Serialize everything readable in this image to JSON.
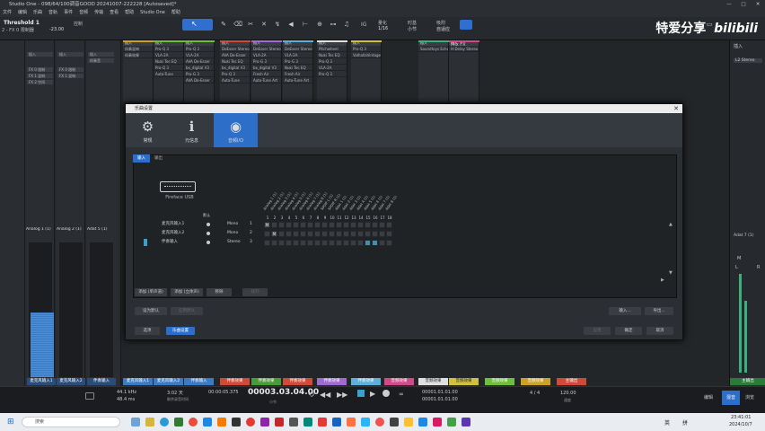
{
  "window": {
    "title": "Studio One - 098/64/100调音GOOD 20241007-222228 [Autosaved]*",
    "controls": [
      "—",
      "□",
      "✕"
    ]
  },
  "menu": [
    "文件",
    "编辑",
    "乐曲",
    "音轨",
    "事件",
    "音频",
    "传输",
    "查看",
    "帮助",
    "Studio One",
    "帮助"
  ],
  "toolbar": {
    "track_label": "Threshold 1",
    "track_sub": "2 - FX 0 限制器",
    "mode_label": "控制",
    "value": "-23.00",
    "quantize_label": "量化",
    "quantize_val": "1/16",
    "timebase_label": "时基",
    "timebase_val": "小节",
    "snap_label": "吸附",
    "snap_val": "自适应",
    "ig": "IG"
  },
  "watermark": {
    "text": "特爱分享",
    "logo": "bilibili"
  },
  "left_channels": [
    {
      "name": "Analog 1 (1)",
      "ins": [
        "插入",
        "FX 0 限制",
        "FX 1 混响",
        "FX 2 空间"
      ],
      "bottom": "麦克风输入1"
    },
    {
      "name": "Analog 2 (1)",
      "ins": [
        "插入",
        "FX 0 限制",
        "FX 1 混响"
      ],
      "bottom": "麦克风输入2"
    },
    {
      "name": "Adat 5 (1)",
      "ins": [
        "插入",
        "伴奏音"
      ],
      "bottom": "伴奏输入"
    }
  ],
  "insert_columns": [
    {
      "color": "#c9a227",
      "slots": [
        "插入",
        "伴奏混响",
        "伴奏效果"
      ]
    },
    {
      "color": "#6fbf3a",
      "slots": [
        "插入",
        "Pro-Q 3",
        "VLA-2A",
        "Nuki Tec EQ",
        "Pro-Q 3",
        "Auto-Tune"
      ]
    },
    {
      "color": "#6fbf3a",
      "slots": [
        "插入",
        "Pro-Q 3",
        "VLA-2A",
        "AVA De-Esser",
        "bx_digital V3",
        "Pro-G 3",
        "AVA De-Esser"
      ]
    },
    {
      "color": "#d04a3a",
      "slots": [
        "插入",
        "DeEsser Stereo",
        "AVA De-Esser",
        "Nuki Tec EQ",
        "bx_digital V3",
        "Pro-Q 3",
        "Auto-Tune"
      ]
    },
    {
      "color": "#a06bd0",
      "slots": [
        "插入",
        "DeEsser Stereo",
        "VLA-2A",
        "Pro-G 3",
        "bx_digital V3",
        "Fresh Air",
        "Auto-Tune Art"
      ]
    },
    {
      "color": "#5fb0d9",
      "slots": [
        "插入",
        "DeEsser Stereo",
        "VLA-2A",
        "Pro-G 3",
        "Nuki Tec EQ",
        "Fresh Air",
        "Auto-Tune Art"
      ]
    },
    {
      "color": "#e0e0e0",
      "slots": [
        "插入",
        "Pitchwheel",
        "Nuki Tec EQ",
        "Pro-Q 3",
        "VLA-2A",
        "Pro-Q 3"
      ]
    },
    {
      "color": "#d0c040",
      "slots": [
        "插入",
        "Pro-Q 3",
        "ValhallaVintage"
      ]
    },
    {
      "color": "#3ab07a",
      "slots": [
        "插入",
        "Soundtoys Echo"
      ]
    },
    {
      "color": "#d04a8a",
      "slots": [
        "插入",
        "H-Delay Stereo"
      ]
    }
  ],
  "mix_fx_label": "Mix FX",
  "right_panel": {
    "label": "插入",
    "stereo": "L2 Stereo",
    "adat": "Adat 7 (1)",
    "mono": "M",
    "l": "L",
    "r": "R",
    "bottom": "主输出"
  },
  "bottom_strips": [
    {
      "label": "麦克风输入1",
      "color": "#3b7bc4"
    },
    {
      "label": "麦克风输入2",
      "color": "#3b7bc4"
    },
    {
      "label": "伴奏输入",
      "color": "#3b7bc4"
    },
    {
      "label": "伴奏效果",
      "color": "#d04a3a"
    },
    {
      "label": "伴奏效果",
      "color": "#4a9a3a"
    },
    {
      "label": "伴奏效果",
      "color": "#d04a3a"
    },
    {
      "label": "伴奏效果",
      "color": "#a06bd0"
    },
    {
      "label": "伴奏效果",
      "color": "#5fb0d9"
    },
    {
      "label": "音频效果",
      "color": "#d04a8a"
    },
    {
      "label": "音频效果",
      "color": "#e0e0e0"
    },
    {
      "label": "音频效果",
      "color": "#d0c040"
    },
    {
      "label": "音频效果",
      "color": "#6fbf3a"
    },
    {
      "label": "音频效果",
      "color": "#c9a227"
    },
    {
      "label": "主输出",
      "color": "#d04a3a"
    }
  ],
  "transport": {
    "sample_rate": "44.1 kHz",
    "latency": "48.4 ms",
    "time": "3:02 天",
    "rec": "剩余录音时间",
    "pos_small": "00:00:05.375",
    "pos_big": "00003.03.04.00",
    "bar_label": "小节",
    "loop_start": "00001.01.01.00",
    "loop_end": "00001.01.01.00",
    "sig": "4 / 4",
    "tempo": "120.00",
    "tempo_label": "速度",
    "edit": "编辑",
    "mix": "混音",
    "browse": "浏览"
  },
  "dialog": {
    "title": "乐曲设置",
    "close": "✕",
    "tabs": [
      {
        "label": "常规",
        "icon": "⚙"
      },
      {
        "label": "元信息",
        "icon": "ℹ"
      },
      {
        "label": "音频I/O",
        "icon": "◉"
      }
    ],
    "sub_tabs": [
      "输入",
      "输出"
    ],
    "device": "Fireface USB",
    "default_header": "默认",
    "columns": [
      "Analog 1 (1)",
      "Analog 2 (1)",
      "Analog 3 (1)",
      "Analog 4 (1)",
      "Analog 5 (1)",
      "Analog 6 (1)",
      "Analog 7 (1)",
      "Analog 8 (1)",
      "SPDIF L (1)",
      "SPDIF R (1)",
      "Adat 1 (1)",
      "Adat 2 (1)",
      "Adat 3 (1)",
      "Adat 4 (1)",
      "Adat 5 (1)",
      "Adat 6 (1)",
      "Adat 7 (1)",
      "Adat 8 (1)"
    ],
    "col_numbers": [
      "1",
      "2",
      "3",
      "4",
      "5",
      "6",
      "7",
      "8",
      "9",
      "10",
      "11",
      "12",
      "13",
      "14",
      "15",
      "16",
      "17",
      "18"
    ],
    "rows": [
      {
        "name": "麦克风输入1",
        "type": "Mono",
        "ch": "1"
      },
      {
        "name": "麦克风输入2",
        "type": "Mono",
        "ch": "2"
      },
      {
        "name": "伴奏输入",
        "type": "Stereo",
        "ch": "3"
      }
    ],
    "cell_marks": [
      "M",
      "M"
    ],
    "buttons_mid": [
      "添加 (单声道)",
      "添加 (立体声)",
      "移除",
      "排列"
    ],
    "buttons_low": [
      "设为默认",
      "应用默认"
    ],
    "buttons_low_right": [
      "输入...",
      "导出..."
    ],
    "footer_left": [
      "选项",
      "乐曲设置"
    ],
    "footer_right": [
      "应用",
      "确定",
      "取消"
    ]
  },
  "taskbar": {
    "search": "搜索",
    "clock": "23:41:01",
    "date": "2024/10/7",
    "lang": "英",
    "ime": "拼"
  }
}
